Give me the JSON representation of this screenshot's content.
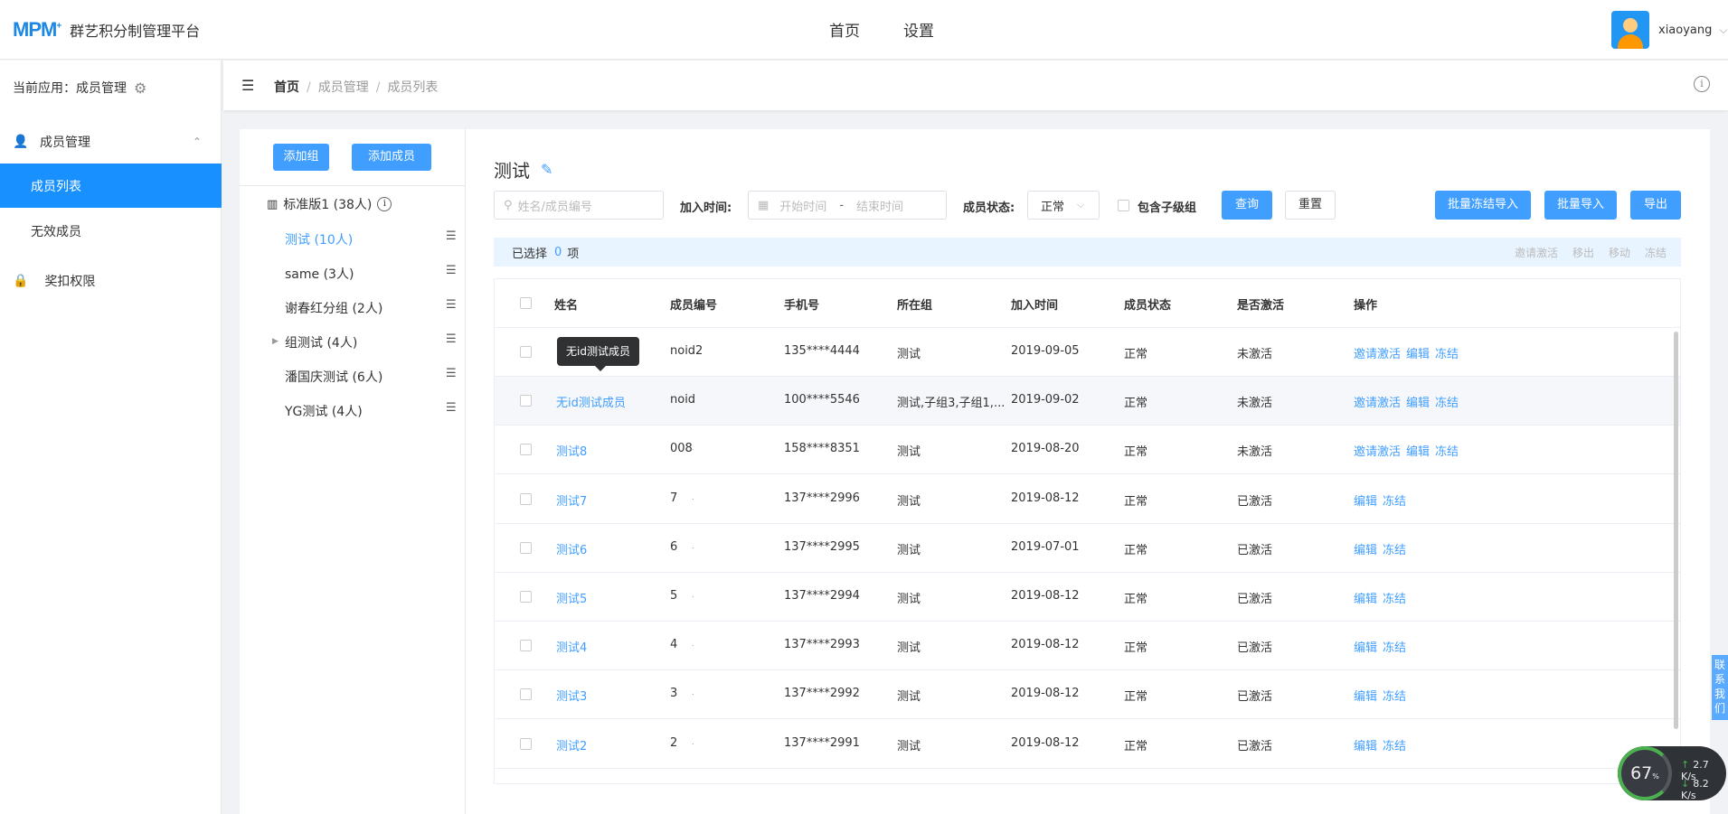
{
  "header": {
    "logo": "MPM",
    "logo_plus": "+",
    "platform": "群艺积分制管理平台",
    "nav": [
      "首页",
      "设置"
    ],
    "username": "xiaoyang"
  },
  "sidebar": {
    "current_app": "当前应用：成员管理",
    "group": "成员管理",
    "items": [
      "成员列表",
      "无效成员"
    ],
    "perm": "奖扣权限"
  },
  "breadcrumb": [
    "首页",
    "成员管理",
    "成员列表"
  ],
  "tree": {
    "add_group": "添加组",
    "add_member": "添加成员",
    "root": "标准版1 (38人)",
    "nodes": [
      "测试 (10人)",
      "same (3人)",
      "谢春红分组 (2人)",
      "组测试 (4人)",
      "潘国庆测试 (6人)",
      "YG测试 (4人)"
    ]
  },
  "main": {
    "title": "测试",
    "search_placeholder": "姓名/成员编号",
    "join_time_label": "加入时间:",
    "start_placeholder": "开始时间",
    "range_sep": "-",
    "end_placeholder": "结束时间",
    "status_label": "成员状态:",
    "status_value": "正常",
    "include_sub": "包含子级组",
    "query": "查询",
    "reset": "重置",
    "batch_freeze_import": "批量冻结导入",
    "batch_import": "批量导入",
    "export": "导出",
    "selected_prefix": "已选择",
    "selected_count": "0",
    "selected_suffix": "项",
    "bulk_actions": [
      "邀请激活",
      "移出",
      "移动",
      "冻结"
    ]
  },
  "table": {
    "headers": [
      "姓名",
      "成员编号",
      "手机号",
      "所在组",
      "加入时间",
      "成员状态",
      "是否激活",
      "操作"
    ],
    "rows": [
      {
        "name": "",
        "code": "noid2",
        "phone": "135****4444",
        "group": "测试",
        "joined": "2019-09-05",
        "status": "正常",
        "active": "未激活",
        "ops": [
          "邀请激活",
          "编辑",
          "冻结"
        ]
      },
      {
        "name": "无id测试成员",
        "code": "noid",
        "phone": "100****5546",
        "group": "测试,子组3,子组1,...",
        "joined": "2019-09-02",
        "status": "正常",
        "active": "未激活",
        "ops": [
          "邀请激活",
          "编辑",
          "冻结"
        ]
      },
      {
        "name": "测试8",
        "code": "008",
        "phone": "158****8351",
        "group": "测试",
        "joined": "2019-08-20",
        "status": "正常",
        "active": "未激活",
        "ops": [
          "邀请激活",
          "编辑",
          "冻结"
        ]
      },
      {
        "name": "测试7",
        "code": "7",
        "phone": "137****2996",
        "group": "测试",
        "joined": "2019-08-12",
        "status": "正常",
        "active": "已激活",
        "ops": [
          "编辑",
          "冻结"
        ]
      },
      {
        "name": "测试6",
        "code": "6",
        "phone": "137****2995",
        "group": "测试",
        "joined": "2019-07-01",
        "status": "正常",
        "active": "已激活",
        "ops": [
          "编辑",
          "冻结"
        ]
      },
      {
        "name": "测试5",
        "code": "5",
        "phone": "137****2994",
        "group": "测试",
        "joined": "2019-08-12",
        "status": "正常",
        "active": "已激活",
        "ops": [
          "编辑",
          "冻结"
        ]
      },
      {
        "name": "测试4",
        "code": "4",
        "phone": "137****2993",
        "group": "测试",
        "joined": "2019-08-12",
        "status": "正常",
        "active": "已激活",
        "ops": [
          "编辑",
          "冻结"
        ]
      },
      {
        "name": "测试3",
        "code": "3",
        "phone": "137****2992",
        "group": "测试",
        "joined": "2019-08-12",
        "status": "正常",
        "active": "已激活",
        "ops": [
          "编辑",
          "冻结"
        ]
      },
      {
        "name": "测试2",
        "code": "2",
        "phone": "137****2991",
        "group": "测试",
        "joined": "2019-08-12",
        "status": "正常",
        "active": "已激活",
        "ops": [
          "编辑",
          "冻结"
        ]
      }
    ]
  },
  "tooltip": "无id测试成员",
  "contact": "联系我们",
  "net_widget": {
    "percent": "67",
    "unit": "%",
    "up": "2.7",
    "down": "8.2",
    "rate_unit": "K/s"
  },
  "colors": {
    "accent": "#409eff",
    "sidebar_active": "#1890ff"
  }
}
